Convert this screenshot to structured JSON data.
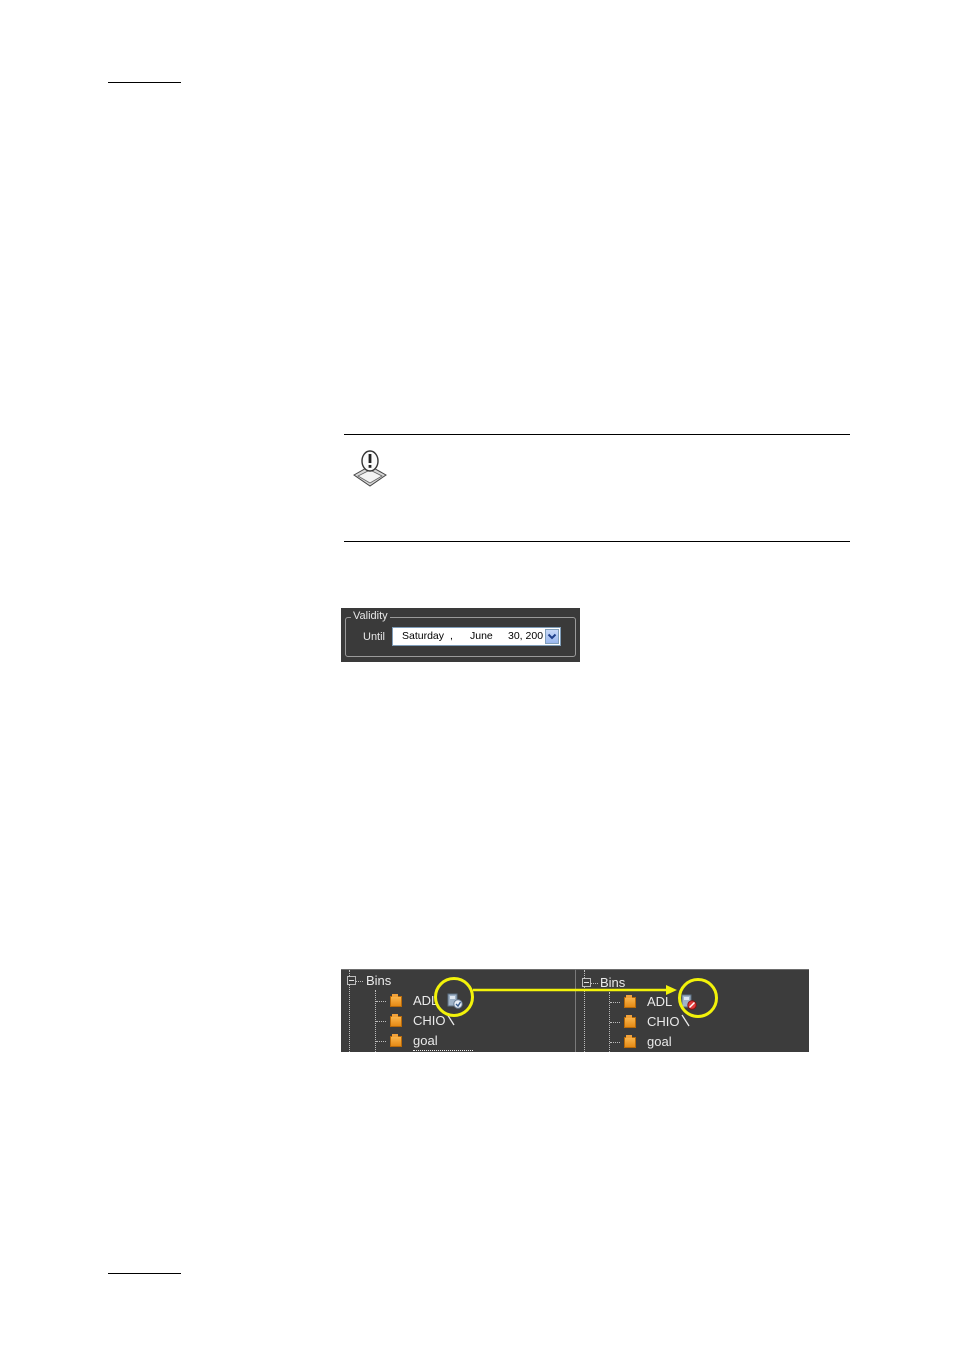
{
  "note": {
    "icon": "important-note-icon"
  },
  "validity": {
    "group_label": "Validity",
    "until_label": "Until",
    "date": {
      "day": "Saturday",
      "sep1": ",",
      "month": "June",
      "rest": "30, 200"
    },
    "dropdown_icon": "chevron-down-icon"
  },
  "bins_before": {
    "root": "Bins",
    "items": [
      "ADL",
      "CHIO",
      "goal"
    ]
  },
  "bins_after": {
    "root": "Bins",
    "items": [
      "ADL",
      "CHIO",
      "goal"
    ]
  },
  "colors": {
    "highlight": "#f2f20a",
    "panel": "#3c3c3c"
  }
}
